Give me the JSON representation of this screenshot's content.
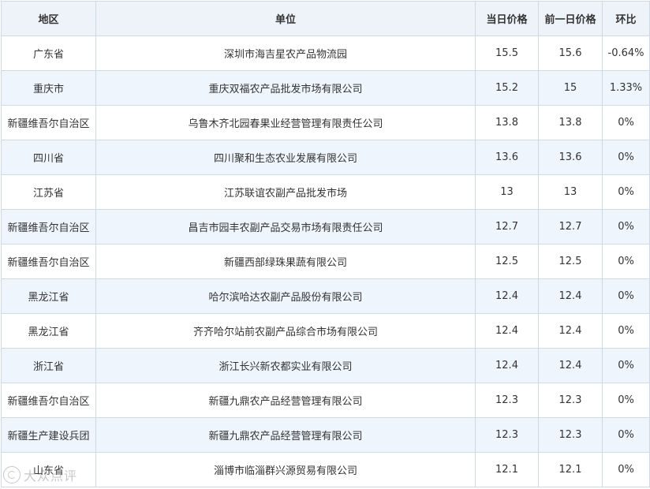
{
  "table": {
    "headers": {
      "region": "地区",
      "unit": "单位",
      "today_price": "当日价格",
      "prev_price": "前一日价格",
      "change": "环比"
    },
    "rows": [
      {
        "region": "广东省",
        "unit": "深圳市海吉星农产品物流园",
        "today": "15.5",
        "prev": "15.6",
        "change": "-0.64%"
      },
      {
        "region": "重庆市",
        "unit": "重庆双福农产品批发市场有限公司",
        "today": "15.2",
        "prev": "15",
        "change": "1.33%"
      },
      {
        "region": "新疆维吾尔自治区",
        "unit": "乌鲁木齐北园春果业经营管理有限责任公司",
        "today": "13.8",
        "prev": "13.8",
        "change": "0%"
      },
      {
        "region": "四川省",
        "unit": "四川聚和生态农业发展有限公司",
        "today": "13.6",
        "prev": "13.6",
        "change": "0%"
      },
      {
        "region": "江苏省",
        "unit": "江苏联谊农副产品批发市场",
        "today": "13",
        "prev": "13",
        "change": "0%"
      },
      {
        "region": "新疆维吾尔自治区",
        "unit": "昌吉市园丰农副产品交易市场有限责任公司",
        "today": "12.7",
        "prev": "12.7",
        "change": "0%"
      },
      {
        "region": "新疆维吾尔自治区",
        "unit": "新疆西部绿珠果蔬有限公司",
        "today": "12.5",
        "prev": "12.5",
        "change": "0%"
      },
      {
        "region": "黑龙江省",
        "unit": "哈尔滨哈达农副产品股份有限公司",
        "today": "12.4",
        "prev": "12.4",
        "change": "0%"
      },
      {
        "region": "黑龙江省",
        "unit": "齐齐哈尔站前农副产品综合市场有限公司",
        "today": "12.4",
        "prev": "12.4",
        "change": "0%"
      },
      {
        "region": "浙江省",
        "unit": "浙江长兴新农都实业有限公司",
        "today": "12.4",
        "prev": "12.4",
        "change": "0%"
      },
      {
        "region": "新疆维吾尔自治区",
        "unit": "新疆九鼎农产品经营管理有限公司",
        "today": "12.3",
        "prev": "12.3",
        "change": "0%"
      },
      {
        "region": "新疆生产建设兵团",
        "unit": "新疆九鼎农产品经营管理有限公司",
        "today": "12.3",
        "prev": "12.3",
        "change": "0%"
      },
      {
        "region": "山东省",
        "unit": "淄博市临淄群兴源贸易有限公司",
        "today": "12.1",
        "prev": "12.1",
        "change": "0%"
      }
    ]
  },
  "watermark": {
    "text": "大众点评"
  }
}
